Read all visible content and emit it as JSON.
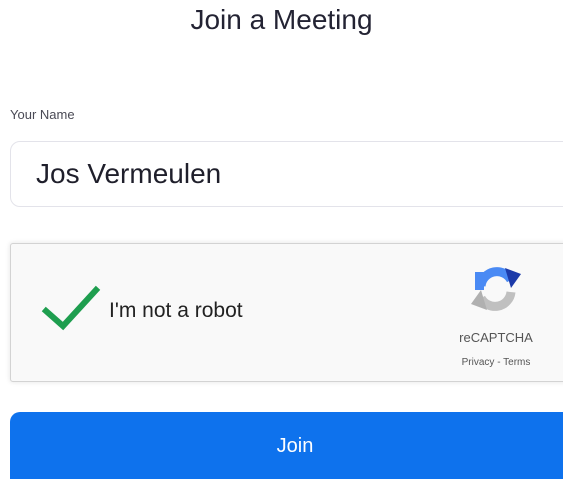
{
  "header": {
    "title": "Join a Meeting"
  },
  "form": {
    "name_label": "Your Name",
    "name_value": "Jos Vermeulen"
  },
  "captcha": {
    "checkbox_label": "I'm not a robot",
    "checked": true,
    "check_color": "#1e9e4f",
    "brand": "reCAPTCHA",
    "privacy_link": "Privacy",
    "separator": " - ",
    "terms_link": "Terms",
    "logo_icon": "recaptcha-logo-icon"
  },
  "actions": {
    "join_label": "Join",
    "join_color": "#0e72ed"
  }
}
